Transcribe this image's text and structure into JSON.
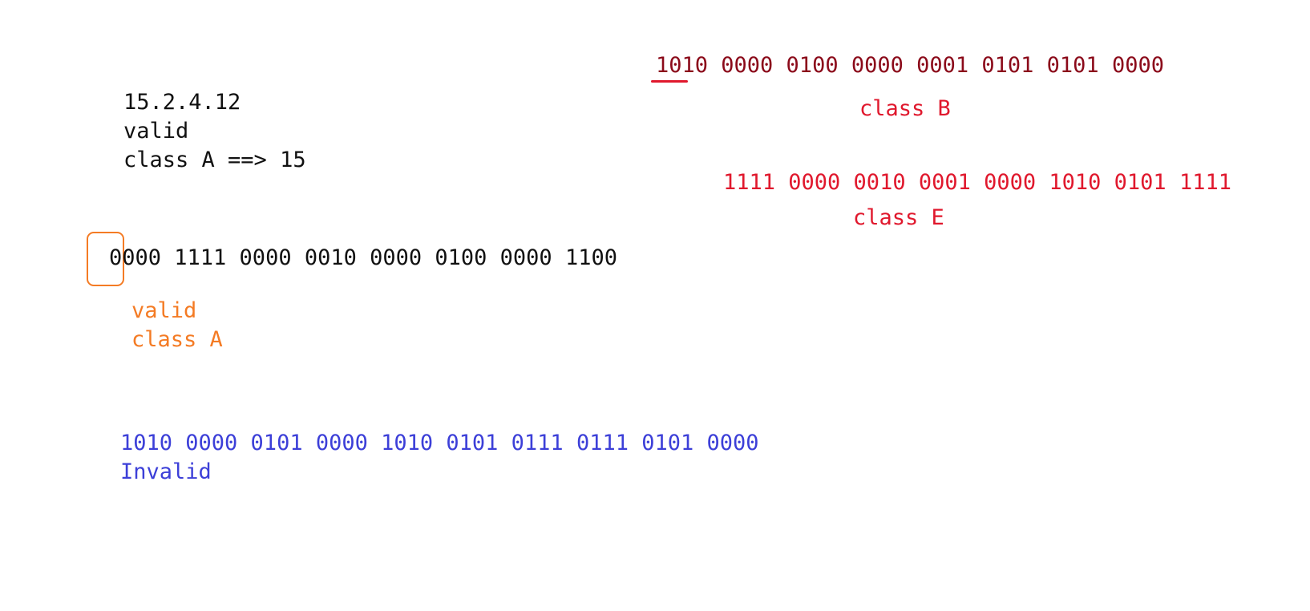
{
  "ip_note": {
    "address": "15.2.4.12",
    "validity": "valid",
    "class_line": "class A ==> 15"
  },
  "class_b_note": {
    "binary": "1010 0000 0100 0000 0001 0101 0101 0000",
    "label": "class B"
  },
  "class_e_note": {
    "binary": "1111 0000 0010 0001 0000 1010 0101 1111",
    "label": "class E"
  },
  "ip_binary_note": {
    "binary": "0000 1111 0000 0010 0000 0100 0000 1100",
    "validity": "valid",
    "class_label": "class A"
  },
  "invalid_note": {
    "binary": "1010 0000 0101 0000 1010 0101 0111 0111 0101 0000",
    "label": "Invalid"
  },
  "colors": {
    "text": "#111111",
    "class_b": "#8b0a1a",
    "class_e": "#e0182d",
    "class_a_annotation": "#f47b24",
    "invalid": "#3c3fd8"
  }
}
